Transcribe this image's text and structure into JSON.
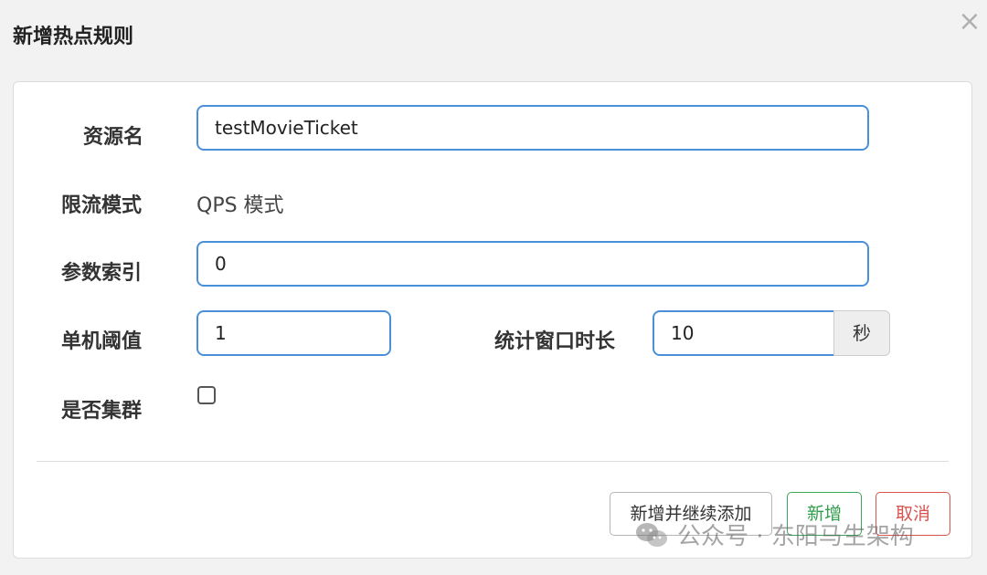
{
  "dialog": {
    "title": "新增热点规则",
    "close_icon": "×"
  },
  "form": {
    "resource": {
      "label": "资源名",
      "value": "testMovieTicket"
    },
    "limit_mode": {
      "label": "限流模式",
      "value": "QPS 模式"
    },
    "param_index": {
      "label": "参数索引",
      "value": "0"
    },
    "threshold": {
      "label": "单机阈值",
      "value": "1"
    },
    "window": {
      "label": "统计窗口时长",
      "value": "10",
      "unit": "秒"
    },
    "cluster": {
      "label": "是否集群",
      "checked": false
    }
  },
  "buttons": {
    "add_continue": "新增并继续添加",
    "add": "新增",
    "cancel": "取消"
  },
  "watermark": {
    "text": "公众号 · 东阳马生架构",
    "icon": "wechat-icon"
  },
  "colors": {
    "input_border": "#4a90d9",
    "add_green": "#2f9e4e",
    "cancel_red": "#d9534f"
  }
}
